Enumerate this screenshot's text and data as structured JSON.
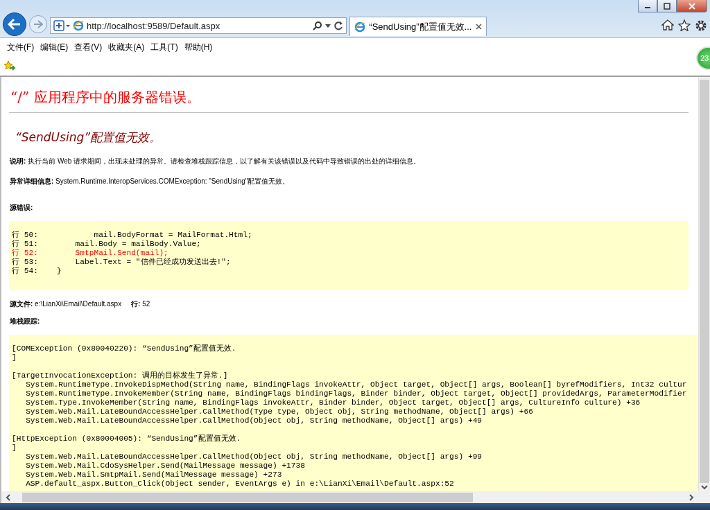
{
  "browser": {
    "address": "http://localhost:9589/Default.aspx",
    "tab_title": "“SendUsing”配置值无效...",
    "menu": [
      "文件(F)",
      "编辑(E)",
      "查看(V)",
      "收藏夹(A)",
      "工具(T)",
      "帮助(H)"
    ],
    "badge": "23"
  },
  "page": {
    "title": "“/” 应用程序中的服务器错误。",
    "subtitle": "“SendUsing”配置值无效。",
    "description": {
      "label": "说明:",
      "text": "执行当前 Web 请求期间，出现未处理的异常。请检查堆栈跟踪信息，以了解有关该错误以及代码中导致错误的出处的详细信息。"
    },
    "details": {
      "label": "异常详细信息:",
      "text": "System.Runtime.InteropServices.COMException: \"SendUsing\"配置值无效。"
    },
    "source_error_label": "源错误:",
    "code_lines": [
      {
        "text": "行 50:            mail.BodyFormat = MailFormat.Html;",
        "highlighted": false
      },
      {
        "text": "行 51:        mail.Body = mailBody.Value;",
        "highlighted": false
      },
      {
        "text": "行 52:        SmtpMail.Send(mail);",
        "highlighted": true
      },
      {
        "text": "行 53:        Label.Text = \"信件已经成功发送出去!\";",
        "highlighted": false
      },
      {
        "text": "行 54:    }",
        "highlighted": false
      }
    ],
    "source_file": {
      "label": "源文件:",
      "value": "e:\\LianXi\\Email\\Default.aspx",
      "line_label": "行:",
      "line": "52"
    },
    "stack_label": "堆栈跟踪:",
    "stack_blocks": [
      [
        "[COMException (0x80040220): “SendUsing”配置值无效.",
        "]"
      ],
      [
        "[TargetInvocationException: 调用的目标发生了异常.]",
        "   System.RuntimeType.InvokeDispMethod(String name, BindingFlags invokeAttr, Object target, Object[] args, Boolean[] byrefModifiers, Int32 cultur",
        "   System.RuntimeType.InvokeMember(String name, BindingFlags bindingFlags, Binder binder, Object target, Object[] providedArgs, ParameterModifier",
        "   System.Type.InvokeMember(String name, BindingFlags invokeAttr, Binder binder, Object target, Object[] args, CultureInfo culture) +36",
        "   System.Web.Mail.LateBoundAccessHelper.CallMethod(Type type, Object obj, String methodName, Object[] args) +66",
        "   System.Web.Mail.LateBoundAccessHelper.CallMethod(Object obj, String methodName, Object[] args) +49"
      ],
      [
        "[HttpException (0x80004005): “SendUsing”配置值无效.",
        "]",
        "   System.Web.Mail.LateBoundAccessHelper.CallMethod(Object obj, String methodName, Object[] args) +99",
        "   System.Web.Mail.CdoSysHelper.Send(MailMessage message) +1738",
        "   System.Web.Mail.SmtpMail.Send(MailMessage message) +273",
        "   ASP.default_aspx.Button_Click(Object sender, EventArgs e) in e:\\LianXi\\Email\\Default.aspx:52"
      ]
    ]
  }
}
